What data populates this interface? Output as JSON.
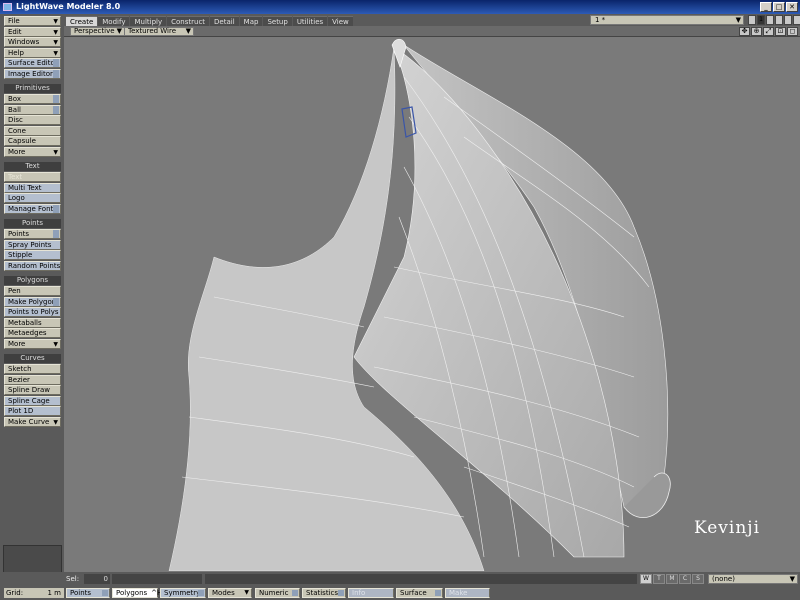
{
  "window": {
    "title": "LightWave Modeler 8.0",
    "buttons": [
      "_",
      "□",
      "✕"
    ]
  },
  "sidebar": {
    "top": [
      {
        "label": "File",
        "arrow": true
      },
      {
        "label": "Edit",
        "arrow": true
      },
      {
        "label": "Windows",
        "arrow": true
      },
      {
        "label": "Help",
        "arrow": true
      },
      {
        "label": "Surface Editor",
        "key": true,
        "blue": true
      },
      {
        "label": "Image Editor",
        "key": true,
        "blue": true
      }
    ],
    "groups": [
      {
        "header": "Primitives",
        "items": [
          {
            "label": "Box",
            "key": true
          },
          {
            "label": "Ball",
            "key": true
          },
          {
            "label": "Disc"
          },
          {
            "label": "Cone"
          },
          {
            "label": "Capsule"
          },
          {
            "label": "More",
            "arrow": true
          }
        ]
      },
      {
        "header": "Text",
        "items": [
          {
            "label": "Text",
            "dim": true
          },
          {
            "label": "Multi Text",
            "blue": true
          },
          {
            "label": "Logo",
            "blue": true
          },
          {
            "label": "Manage Fonts",
            "key": true,
            "blue": true
          }
        ]
      },
      {
        "header": "Points",
        "items": [
          {
            "label": "Points",
            "key": true
          },
          {
            "label": "Spray Points",
            "blue": true
          },
          {
            "label": "Stipple",
            "blue": true
          },
          {
            "label": "Random Points",
            "blue": true
          }
        ]
      },
      {
        "header": "Polygons",
        "items": [
          {
            "label": "Pen"
          },
          {
            "label": "Make Polygon",
            "key": true,
            "blue": true
          },
          {
            "label": "Points to Polys",
            "blue": true
          },
          {
            "label": "Metaballs"
          },
          {
            "label": "Metaedges"
          },
          {
            "label": "More",
            "arrow": true
          }
        ]
      },
      {
        "header": "Curves",
        "items": [
          {
            "label": "Sketch"
          },
          {
            "label": "Bezier"
          },
          {
            "label": "Spline Draw"
          },
          {
            "label": "Spline Cage",
            "blue": true
          },
          {
            "label": "Plot 1D",
            "blue": true
          },
          {
            "label": "Make Curve",
            "arrow": true
          }
        ]
      }
    ]
  },
  "tabs": [
    "Create",
    "Modify",
    "Multiply",
    "Construct",
    "Detail",
    "Map",
    "Setup",
    "Utilities",
    "View"
  ],
  "active_tab": "Create",
  "layer_select": "1 *",
  "layer_boxes": [
    "",
    "1",
    "",
    "",
    "",
    "",
    ""
  ],
  "viewport": {
    "view": "Perspective",
    "shading": "Textured Wire",
    "icons": [
      "✥",
      "⊕",
      "⤢",
      "⊡",
      "◻"
    ],
    "watermark": "Kevinji"
  },
  "status": {
    "sel_label": "Sel:",
    "sel_value": "0",
    "toggles": [
      {
        "label": "W",
        "on": true
      },
      {
        "label": "T"
      },
      {
        "label": "M"
      },
      {
        "label": "C"
      },
      {
        "label": "S"
      }
    ],
    "surface": "(none)"
  },
  "bottom": {
    "grid_label": "Grid:",
    "grid_value": "1 m",
    "buttons": [
      {
        "label": "Points",
        "blue": true,
        "key": true
      },
      {
        "label": "Polygons",
        "white": true,
        "shortcut": "^H"
      },
      {
        "label": "Symmetry",
        "blue": true,
        "key": true
      },
      {
        "label": "Modes",
        "arrow": true
      },
      {
        "label": "Numeric",
        "key": true
      },
      {
        "label": "Statistics",
        "key": true
      },
      {
        "label": "Info",
        "disabled": true
      },
      {
        "label": "Surface",
        "key": true
      },
      {
        "label": "Make",
        "disabled": true
      }
    ]
  }
}
